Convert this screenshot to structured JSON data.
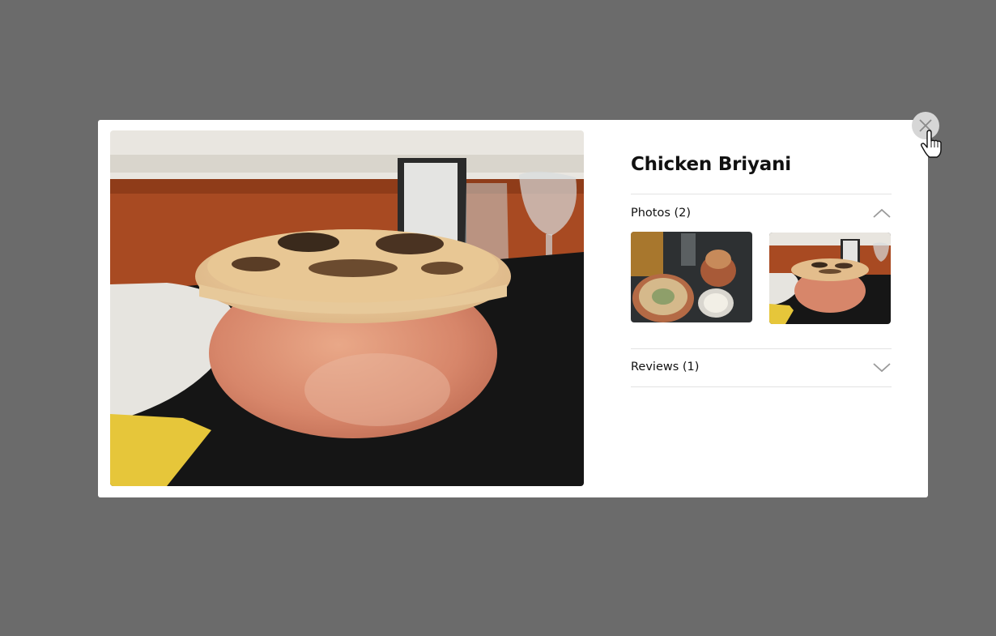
{
  "modal": {
    "title": "Chicken Briyani",
    "hero_image": "photo of a clay pot biryani sealed with baked dough crust on a black tablecloth",
    "photos": {
      "label": "Photos (2)",
      "expanded": true,
      "chevron": "chevron-up-icon",
      "items": [
        {
          "image": "biryani in clay bowl with raita and drinks, top view"
        },
        {
          "image": "clay pot biryani with baked dough crust, side view"
        }
      ]
    },
    "reviews": {
      "label": "Reviews (1)",
      "expanded": false,
      "chevron": "chevron-down-icon"
    },
    "close_icon": "close-icon"
  },
  "colors": {
    "overlay": "#6b6b6b",
    "modal_bg": "#ffffff",
    "divider": "#e3e3e3",
    "close_bg": "#d6d6d6"
  }
}
